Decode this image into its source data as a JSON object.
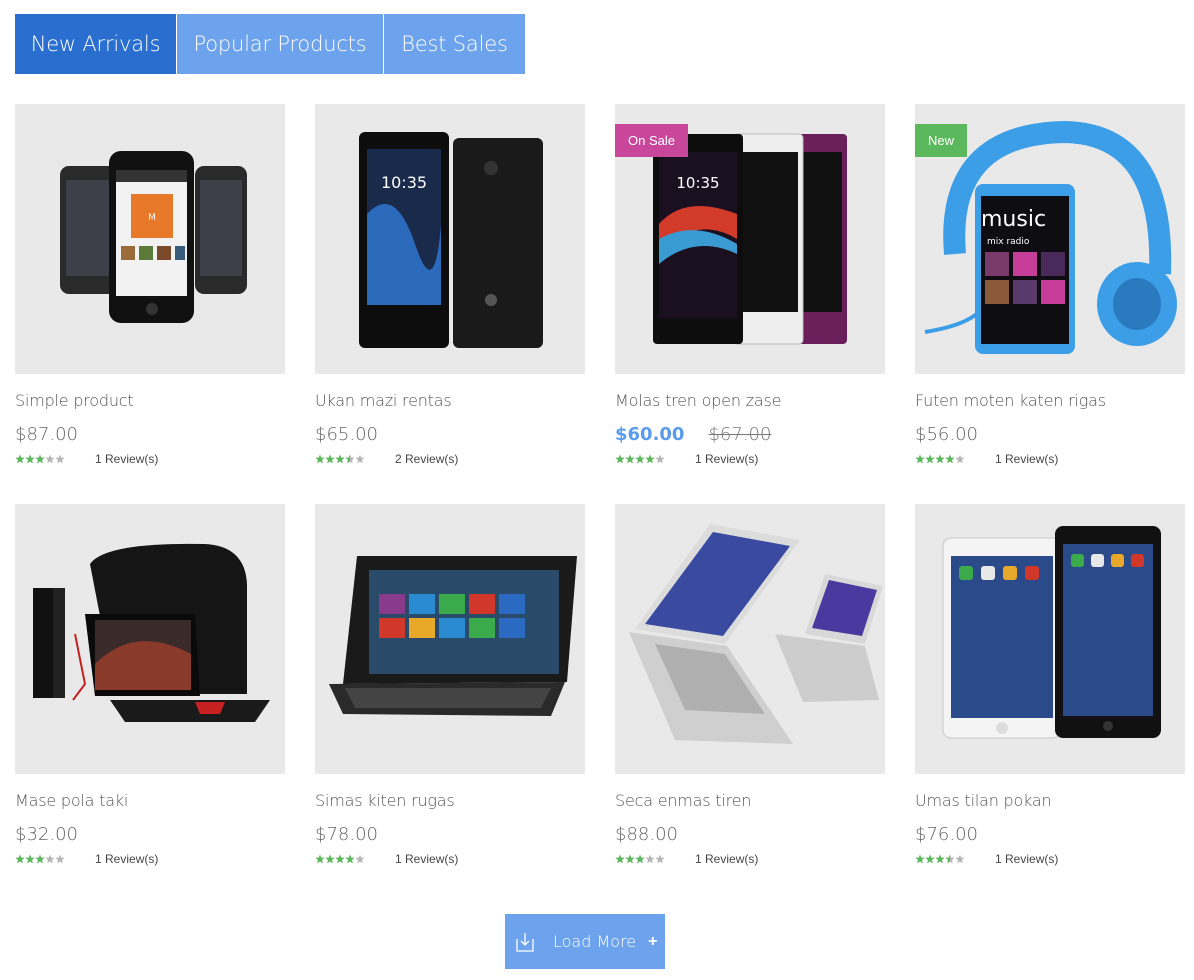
{
  "tabs": [
    {
      "label": "New Arrivals",
      "active": true
    },
    {
      "label": "Popular Products",
      "active": false
    },
    {
      "label": "Best Sales",
      "active": false
    }
  ],
  "products": [
    {
      "name": "Simple product",
      "price": "$87.00",
      "rating": 3,
      "reviews": "1 Review(s)",
      "image_icon": "smartphones-image"
    },
    {
      "name": "Ukan mazi rentas",
      "price": "$65.00",
      "rating": 3.5,
      "reviews": "2 Review(s)",
      "image_icon": "sony-xperia-image"
    },
    {
      "name": "Molas tren open zase",
      "special_price": "$60.00",
      "old_price": "$67.00",
      "rating": 4,
      "reviews": "1 Review(s)",
      "badge": "On Sale",
      "image_icon": "xperia-z-image"
    },
    {
      "name": "Futen moten katen rigas",
      "price": "$56.00",
      "rating": 4,
      "reviews": "1 Review(s)",
      "badge": "New",
      "image_icon": "nokia-headphones-image"
    },
    {
      "name": "Mase pola taki",
      "price": "$32.00",
      "rating": 3,
      "reviews": "1 Review(s)",
      "image_icon": "gaming-pc-image"
    },
    {
      "name": "Simas kiten rugas",
      "price": "$78.00",
      "rating": 4,
      "reviews": "1 Review(s)",
      "image_icon": "slider-tablet-image"
    },
    {
      "name": "Seca enmas tiren",
      "price": "$88.00",
      "rating": 3,
      "reviews": "1 Review(s)",
      "image_icon": "ultrabook-image"
    },
    {
      "name": "Umas tilan pokan",
      "price": "$76.00",
      "rating": 3.5,
      "reviews": "1 Review(s)",
      "image_icon": "ipad-image"
    }
  ],
  "load_more": {
    "label": "Load More",
    "plus": "+"
  },
  "colors": {
    "tab_active": "#2a6fd0",
    "tab_inactive": "#6da3ec",
    "special_price": "#5b9bec",
    "badge_sale": "#c9479a",
    "badge_new": "#5cb85c",
    "star_filled": "#5cb85c",
    "star_empty": "#b5b5b5"
  }
}
